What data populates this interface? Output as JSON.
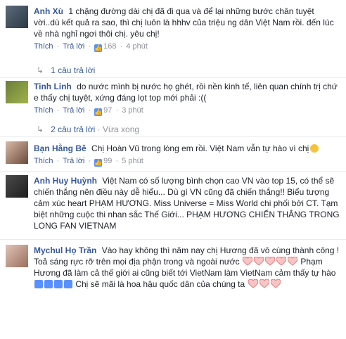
{
  "comments": [
    {
      "author": "Anh Xù",
      "text": "1 chặng đường dài chị đã đi qua và để lại những bước chân tuyệt vời..dù kết quả ra sao, thì chị luôn là hhhv của triệu ng dân Việt Nam rồi. đến lúc về nhà nghỉ ngơi thôi chị. yêu chị!",
      "like_label": "Thích",
      "reply_label": "Trả lời",
      "likes": "168",
      "time": "4 phút",
      "replies": "1 câu trả lời"
    },
    {
      "author": "Tinh Linh",
      "text": "do nước mình bị nước họ ghét, rồi nền kinh tế, liên quan chính trị chứ e thấy chị tuyệt, xứng đáng lọt top mới phải :((",
      "like_label": "Thích",
      "reply_label": "Trả lời",
      "likes": "97",
      "time": "3 phút",
      "replies": "2 câu trả lời",
      "replies_extra": "Vừa xong"
    },
    {
      "author": "Bạn Hằng Bê",
      "text": "Chị Hoàn Vũ trong lòng em rồi. Việt Nam vẫn tự hào vì chị",
      "like_label": "Thích",
      "reply_label": "Trả lời",
      "likes": "99",
      "time": "5 phút"
    },
    {
      "author": "Anh Huy Huỳnh",
      "text": "Việt Nam có số lượng bình chọn cao VN vào top 15, có thể sẽ chiến thắng nên điều này dễ hiểu... Dù gì VN cũng đã chiến thắng!! Biểu tượng cảm xúc heart PHẠM HƯƠNG. Miss Universe = Miss World chi phối bởi CT. Tạm biệt những cuộc thi nhan sắc Thế Giới... PHẠM HƯƠNG CHIẾN THẮNG TRONG LONG FAN VIETNAM"
    },
    {
      "author": "Mychul Họ Trần",
      "text_1": "Vào hay không thì năm nay chị Hương đã vô cùng thành công ! Toả sáng rực rỡ trên mọi địa phận trong và ngoài nước",
      "text_2": "Phạm Hương đã làm cả thế giới ai cũng biết tới VietNam làm VietNam cảm thấy tự hào",
      "text_3": "Chị sẽ mãi là hoa hậu quốc dân của chúng ta"
    }
  ],
  "separator": "·"
}
